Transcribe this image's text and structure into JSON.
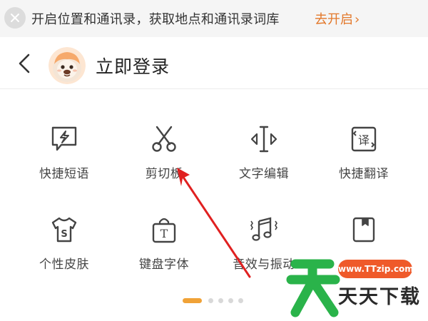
{
  "banner": {
    "close_icon": "close-icon",
    "text": "开启位置和通讯录，获取地点和通讯录词库",
    "action": "去开启",
    "action_chevron": "›",
    "colors": {
      "background": "#f5f5f5",
      "action": "#e3782a"
    }
  },
  "header": {
    "back_icon": "back-arrow-icon",
    "avatar_icon": "monkey-avatar-icon",
    "title": "立即登录"
  },
  "grid": [
    {
      "label": "快捷短语",
      "icon": "lightning-bubble-icon"
    },
    {
      "label": "剪切板",
      "icon": "scissors-icon"
    },
    {
      "label": "文字编辑",
      "icon": "text-cursor-icon"
    },
    {
      "label": "快捷翻译",
      "icon": "translate-icon"
    },
    {
      "label": "个性皮肤",
      "icon": "tshirt-icon"
    },
    {
      "label": "键盘字体",
      "icon": "font-bag-icon"
    },
    {
      "label": "音效与振动",
      "icon": "music-vibration-icon"
    },
    {
      "label": "",
      "icon": "bookmark-icon"
    }
  ],
  "pager": {
    "pages": 5,
    "active": 0,
    "active_color": "#f0a237"
  },
  "watermark": {
    "url": "www.TTzip.com",
    "text": "天天下载",
    "color": "#2ab34a"
  },
  "annotation": {
    "type": "red-arrow",
    "color": "#e02020"
  }
}
